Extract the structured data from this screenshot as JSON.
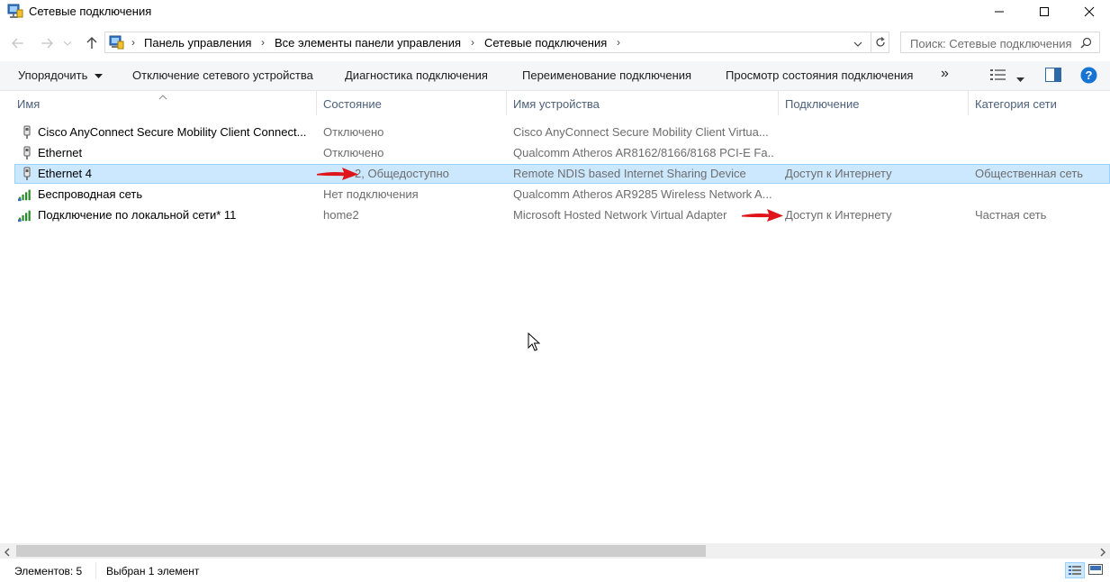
{
  "window": {
    "title": "Сетевые подключения"
  },
  "address": {
    "breadcrumbs": [
      "Панель управления",
      "Все элементы панели управления",
      "Сетевые подключения"
    ]
  },
  "search": {
    "placeholder": "Поиск: Сетевые подключения"
  },
  "commands": {
    "organize": "Упорядочить",
    "disable": "Отключение сетевого устройства",
    "diagnose": "Диагностика подключения",
    "rename": "Переименование подключения",
    "status": "Просмотр состояния подключения",
    "more": "»"
  },
  "columns": {
    "name": "Имя",
    "state": "Состояние",
    "device": "Имя устройства",
    "connectivity": "Подключение",
    "category": "Категория сети"
  },
  "rows": [
    {
      "name": "Cisco AnyConnect Secure Mobility Client Connect...",
      "state": "Отключено",
      "device": "Cisco AnyConnect Secure Mobility Client Virtua...",
      "connectivity": "",
      "category": "",
      "icon": "ethernet-adapter-icon"
    },
    {
      "name": "Ethernet",
      "state": "Отключено",
      "device": "Qualcomm Atheros AR8162/8166/8168 PCI-E Fa...",
      "connectivity": "",
      "category": "",
      "icon": "ethernet-adapter-icon"
    },
    {
      "name": "Ethernet 4",
      "state": "Сеть 2, Общедоступно",
      "state_visible": "2, Общедоступно",
      "device": "Remote NDIS based Internet Sharing Device",
      "connectivity": "Доступ к Интернету",
      "category": "Общественная сеть",
      "icon": "ethernet-adapter-icon",
      "selected": true
    },
    {
      "name": "Беспроводная сеть",
      "state": "Нет подключения",
      "device": "Qualcomm Atheros AR9285 Wireless Network A...",
      "connectivity": "",
      "category": "",
      "icon": "wifi-signal-icon"
    },
    {
      "name": "Подключение по локальной сети* 11",
      "state": "home2",
      "device": "Microsoft Hosted Network Virtual Adapter",
      "connectivity": "Доступ к Интернету",
      "category": "Частная сеть",
      "icon": "wifi-signal-icon"
    }
  ],
  "statusbar": {
    "count": "Элементов: 5",
    "selection": "Выбран 1 элемент"
  },
  "colors": {
    "selection_bg": "#cce8ff",
    "selection_border": "#99d1ff",
    "arrow": "#e0141b",
    "header_text": "#4c607a"
  }
}
